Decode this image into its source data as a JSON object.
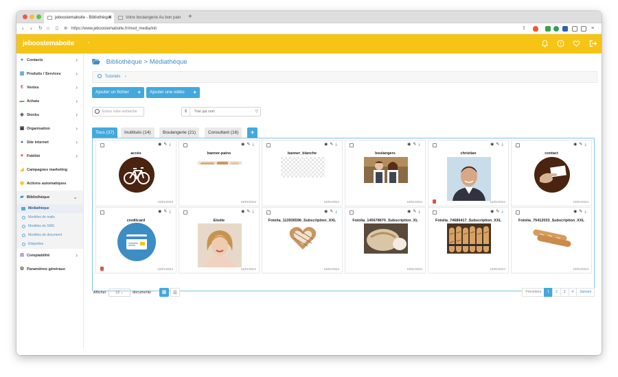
{
  "browser": {
    "tabs": [
      {
        "label": "jeboostemaboite - Bibliothèque"
      },
      {
        "label": "Votre boulangerie Au bon pain"
      }
    ],
    "url": "https://www.jeboostemaboite.fr/med_media/init"
  },
  "app": {
    "logo": "jeboostemaboite"
  },
  "sidebar": {
    "items": [
      {
        "label": "Contacts",
        "icon": "user-icon",
        "color": "#3d8dc5"
      },
      {
        "label": "Produits / Services",
        "icon": "columns-icon",
        "color": "#3d8dc5"
      },
      {
        "label": "Ventes",
        "icon": "euro-icon",
        "color": "#d9534f"
      },
      {
        "label": "Achats",
        "icon": "cart-icon",
        "color": "#5cb85c"
      },
      {
        "label": "Stocks",
        "icon": "cubes-icon",
        "color": "#555555"
      },
      {
        "label": "Organisation",
        "icon": "calendar-icon",
        "color": "#333333"
      },
      {
        "label": "Site internet",
        "icon": "globe-icon",
        "color": "#3d6dc5"
      },
      {
        "label": "Fidélité",
        "icon": "heart-icon",
        "color": "#d9534f"
      },
      {
        "label": "Campagnes marketing",
        "icon": "bullhorn-icon",
        "color": "#f5c415"
      },
      {
        "label": "Actions automatiques",
        "icon": "clock-icon",
        "color": "#f5c415"
      },
      {
        "label": "Bibliothèque",
        "icon": "folder-icon",
        "color": "#3d8dc5"
      },
      {
        "label": "Comptabilité",
        "icon": "balance-icon",
        "color": "#8a4fbf"
      },
      {
        "label": "Paramètres généraux",
        "icon": "gear-icon",
        "color": "#555555"
      }
    ],
    "submenu": [
      {
        "label": "Médiathèque"
      },
      {
        "label": "Modèles de mails"
      },
      {
        "label": "Modèles de SMS"
      },
      {
        "label": "Modèles de document"
      },
      {
        "label": "Etiquettes"
      }
    ]
  },
  "main": {
    "title_part1": "Bibliothèque",
    "title_sep": ">",
    "title_part2": "Médiathèque",
    "tutorials": "Tutoriels",
    "add_file": "Ajouter un fichier",
    "add_video": "Ajouter une vidéo",
    "search_placeholder": "Entrez votre recherche",
    "sort_label": "Trier par nom",
    "filter_tabs": [
      {
        "label": "Tous (37)"
      },
      {
        "label": "Inutilisés (14)"
      },
      {
        "label": "Boulangerie (21)"
      },
      {
        "label": "Consultant (16)"
      }
    ],
    "add_tab": "+",
    "media": [
      {
        "name": "accès",
        "date": "19/01/2024",
        "kind": "bike"
      },
      {
        "name": "banner-pains",
        "date": "19/01/2024",
        "kind": "banner"
      },
      {
        "name": "banner_blanche",
        "date": "19/01/2024",
        "kind": "blank"
      },
      {
        "name": "boulangers",
        "date": "19/01/2024",
        "kind": "bakers"
      },
      {
        "name": "christian",
        "date": "16/01/2024",
        "kind": "man"
      },
      {
        "name": "contact",
        "date": "19/01/2024",
        "kind": "hand"
      },
      {
        "name": "creditcard",
        "date": "16/01/2024",
        "kind": "card"
      },
      {
        "name": "Elodie",
        "date": "16/01/2024",
        "kind": "woman"
      },
      {
        "name": "Fotolia_113936596_Subscription_XXL",
        "date": "19/01/2024",
        "kind": "heartbread"
      },
      {
        "name": "Fotolia_145678670_Subscription_XL",
        "date": "19/01/2024",
        "kind": "loaf"
      },
      {
        "name": "Fotolia_74686417_Subscription_XXL",
        "date": "19/01/2024",
        "kind": "baguettes"
      },
      {
        "name": "Fotolia_75412033_Subscription_XXL",
        "date": "19/01/2024",
        "kind": "baguette2"
      }
    ],
    "show_label": "Afficher",
    "per_page": "12",
    "documents_label": "documents",
    "pagination": {
      "prev": "Précédent",
      "pages": [
        "1",
        "2",
        "3",
        "4"
      ],
      "next": "Suivant"
    }
  }
}
